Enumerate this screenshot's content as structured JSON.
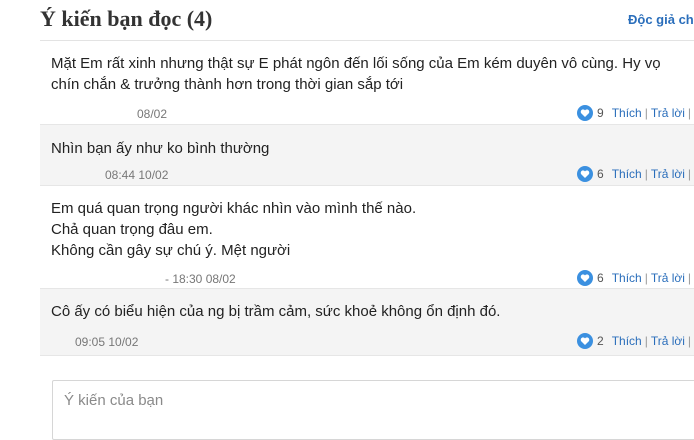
{
  "header": {
    "title": "Ý kiến bạn đọc (4)",
    "reader_link": "Độc giả ch"
  },
  "comments": [
    {
      "text": "Mặt Em rất xinh nhưng thật sự E phát ngôn đến lối sống của Em kém duyên vô cùng. Hy vọ\nchín chắn & trưởng thành hơn trong thời gian sắp tới",
      "author": "",
      "time": "08/02",
      "likes": "9",
      "like_label": "Thích",
      "reply_label": "Trả lời",
      "trail": "|"
    },
    {
      "text": "Nhìn bạn ấy như ko bình thường",
      "author": "",
      "time": "08:44 10/02",
      "likes": "6",
      "like_label": "Thích",
      "reply_label": "Trả lời",
      "trail": "|"
    },
    {
      "text": "Em quá quan trọng người khác nhìn vào mình thế nào.\nChả quan trọng đâu em.\nKhông cần gây sự chú ý. Mệt người",
      "author": "",
      "time": "- 18:30 08/02",
      "likes": "6",
      "like_label": "Thích",
      "reply_label": "Trả lời",
      "trail": "|"
    },
    {
      "text": "Cô ấy có biểu hiện của ng bị trầm cảm, sức khoẻ không ổn định đó.",
      "author": "",
      "time": "09:05 10/02",
      "likes": "2",
      "like_label": "Thích",
      "reply_label": "Trả lời",
      "trail": "|"
    }
  ],
  "comment_input": {
    "placeholder": "Ý kiến của bạn"
  },
  "colors": {
    "accent": "#2a6ebb",
    "like_icon": "#3b90e0",
    "alt_row": "#f4f4f4"
  },
  "icons": {
    "like": "heart-icon"
  }
}
